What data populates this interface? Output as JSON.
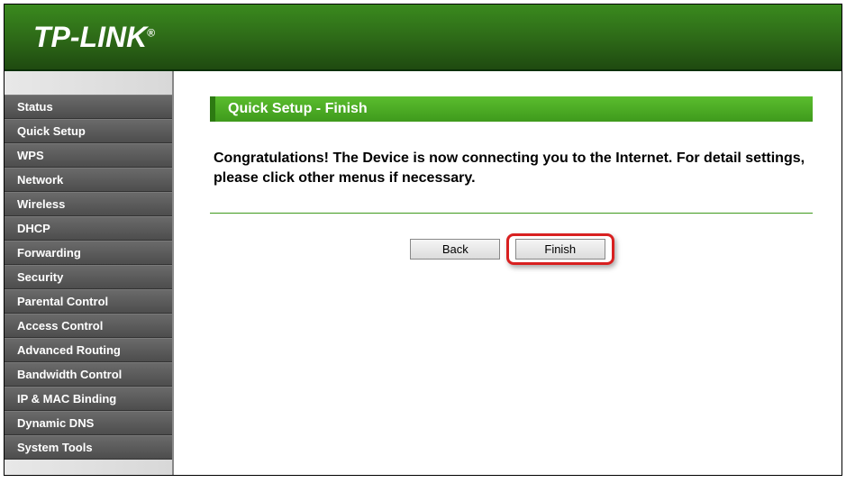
{
  "brand": "TP-LINK",
  "sidebar": {
    "items": [
      {
        "label": "Status"
      },
      {
        "label": "Quick Setup"
      },
      {
        "label": "WPS"
      },
      {
        "label": "Network"
      },
      {
        "label": "Wireless"
      },
      {
        "label": "DHCP"
      },
      {
        "label": "Forwarding"
      },
      {
        "label": "Security"
      },
      {
        "label": "Parental Control"
      },
      {
        "label": "Access Control"
      },
      {
        "label": "Advanced Routing"
      },
      {
        "label": "Bandwidth Control"
      },
      {
        "label": "IP & MAC Binding"
      },
      {
        "label": "Dynamic DNS"
      },
      {
        "label": "System Tools"
      }
    ]
  },
  "main": {
    "title": "Quick Setup - Finish",
    "message": "Congratulations! The Device is now connecting you to the Internet. For detail settings, please click other menus if necessary.",
    "back_label": "Back",
    "finish_label": "Finish"
  }
}
